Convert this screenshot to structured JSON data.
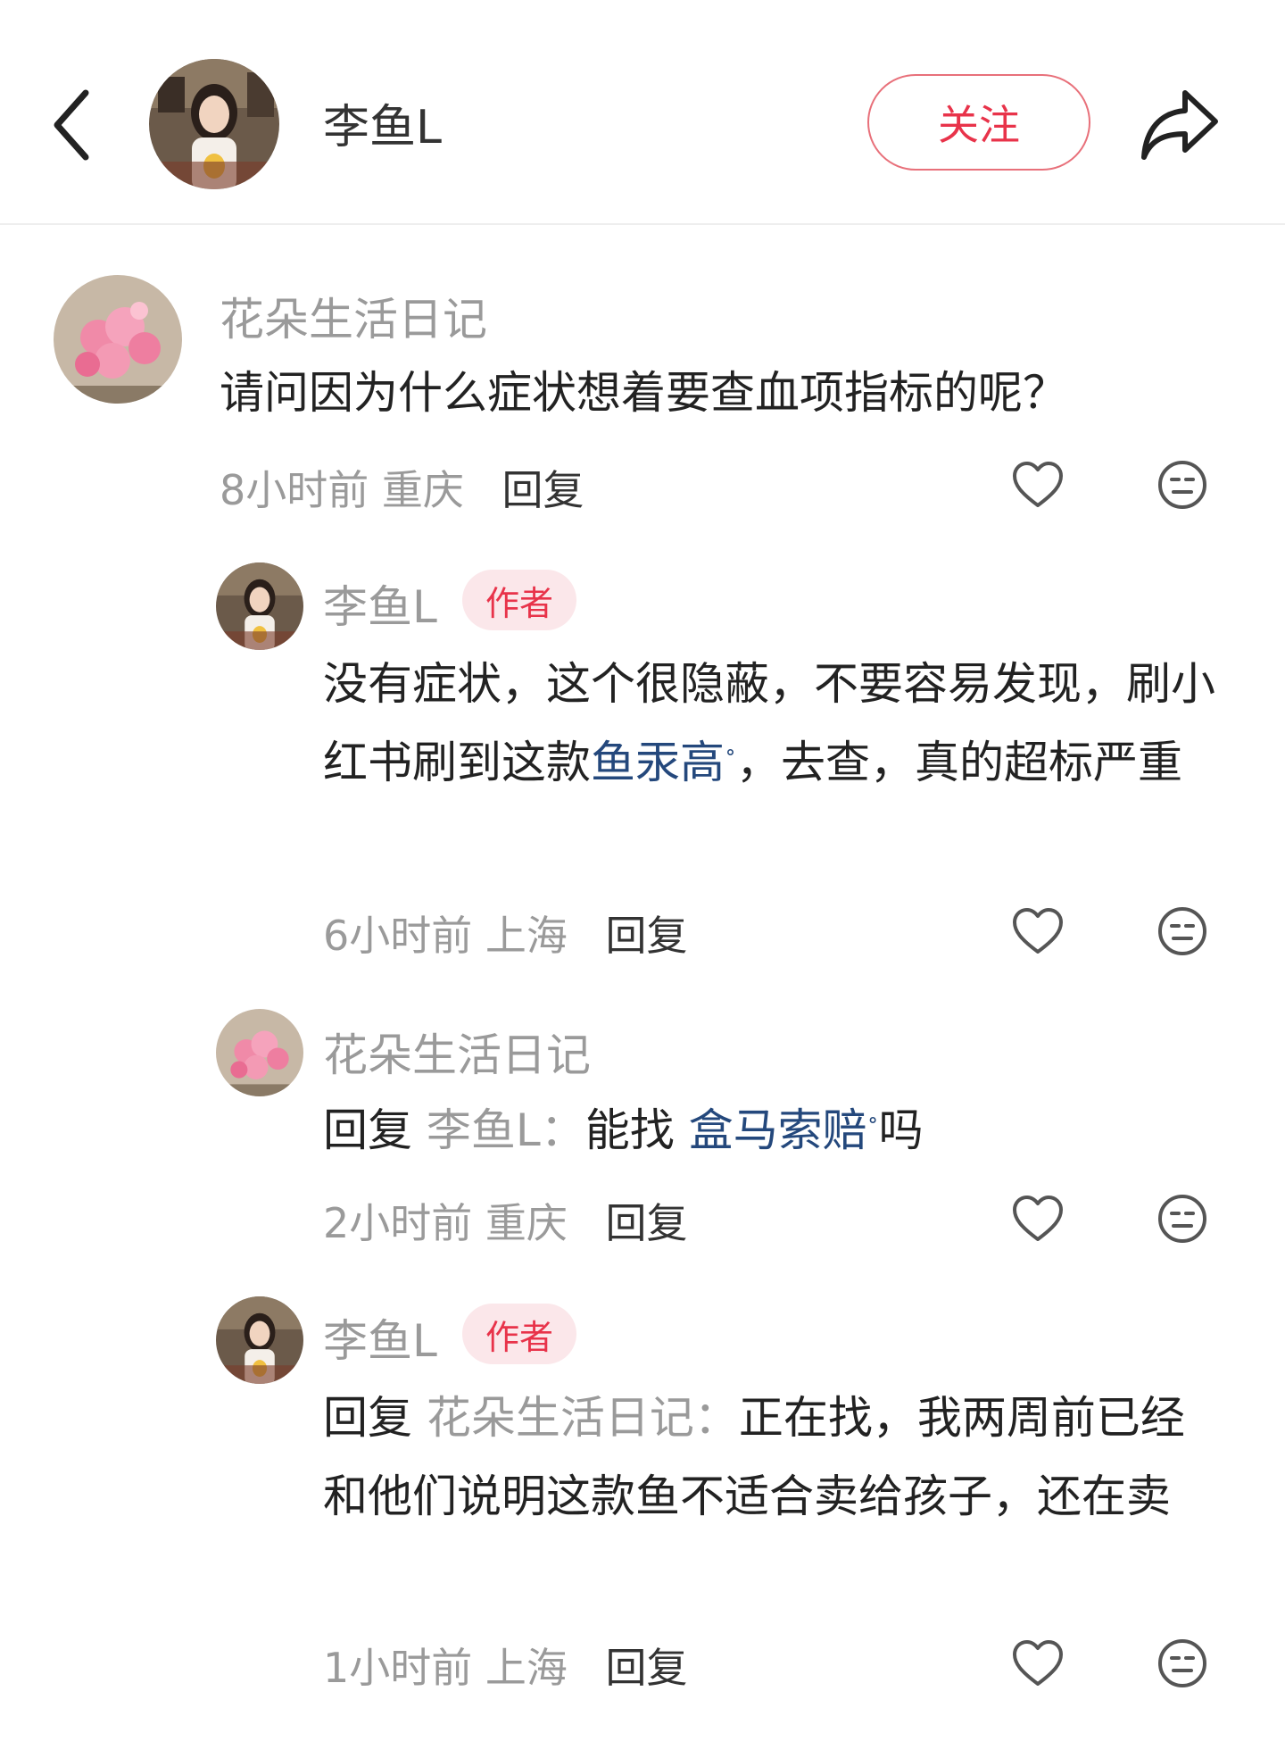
{
  "header": {
    "author_name": "李鱼L",
    "follow_label": "关注"
  },
  "comments": [
    {
      "user": "花朵生活日记",
      "text": "请问因为什么症状想着要查血项指标的呢？",
      "time": "8小时前",
      "location": "重庆",
      "reply_label": "回复"
    },
    {
      "user": "李鱼L",
      "badge": "作者",
      "text_before": "没有症状，这个很隐蔽，不要容易发现，刷小红书刷到这款",
      "link": "鱼汞高",
      "text_after": "，去查，真的超标严重",
      "time": "6小时前",
      "location": "上海",
      "reply_label": "回复"
    },
    {
      "user": "花朵生活日记",
      "reply_prefix": "回复",
      "mention": "李鱼L：",
      "text_before": "能找",
      "link": "盒马索赔",
      "text_after": "吗",
      "time": "2小时前",
      "location": "重庆",
      "reply_label": "回复"
    },
    {
      "user": "李鱼L",
      "badge": "作者",
      "reply_prefix": "回复",
      "mention": "花朵生活日记：",
      "text": "正在找，我两周前已经和他们说明这款鱼不适合卖给孩子，还在卖",
      "time": "1小时前",
      "location": "上海",
      "reply_label": "回复"
    }
  ],
  "icons": {
    "back": "chevron-left-icon",
    "share": "share-arrow-icon",
    "like": "heart-outline-icon",
    "emoji": "neutral-face-icon",
    "search_hint": "search-small-icon"
  },
  "colors": {
    "accent": "#e8334a",
    "link": "#24487c",
    "muted": "#9a9a9a"
  }
}
